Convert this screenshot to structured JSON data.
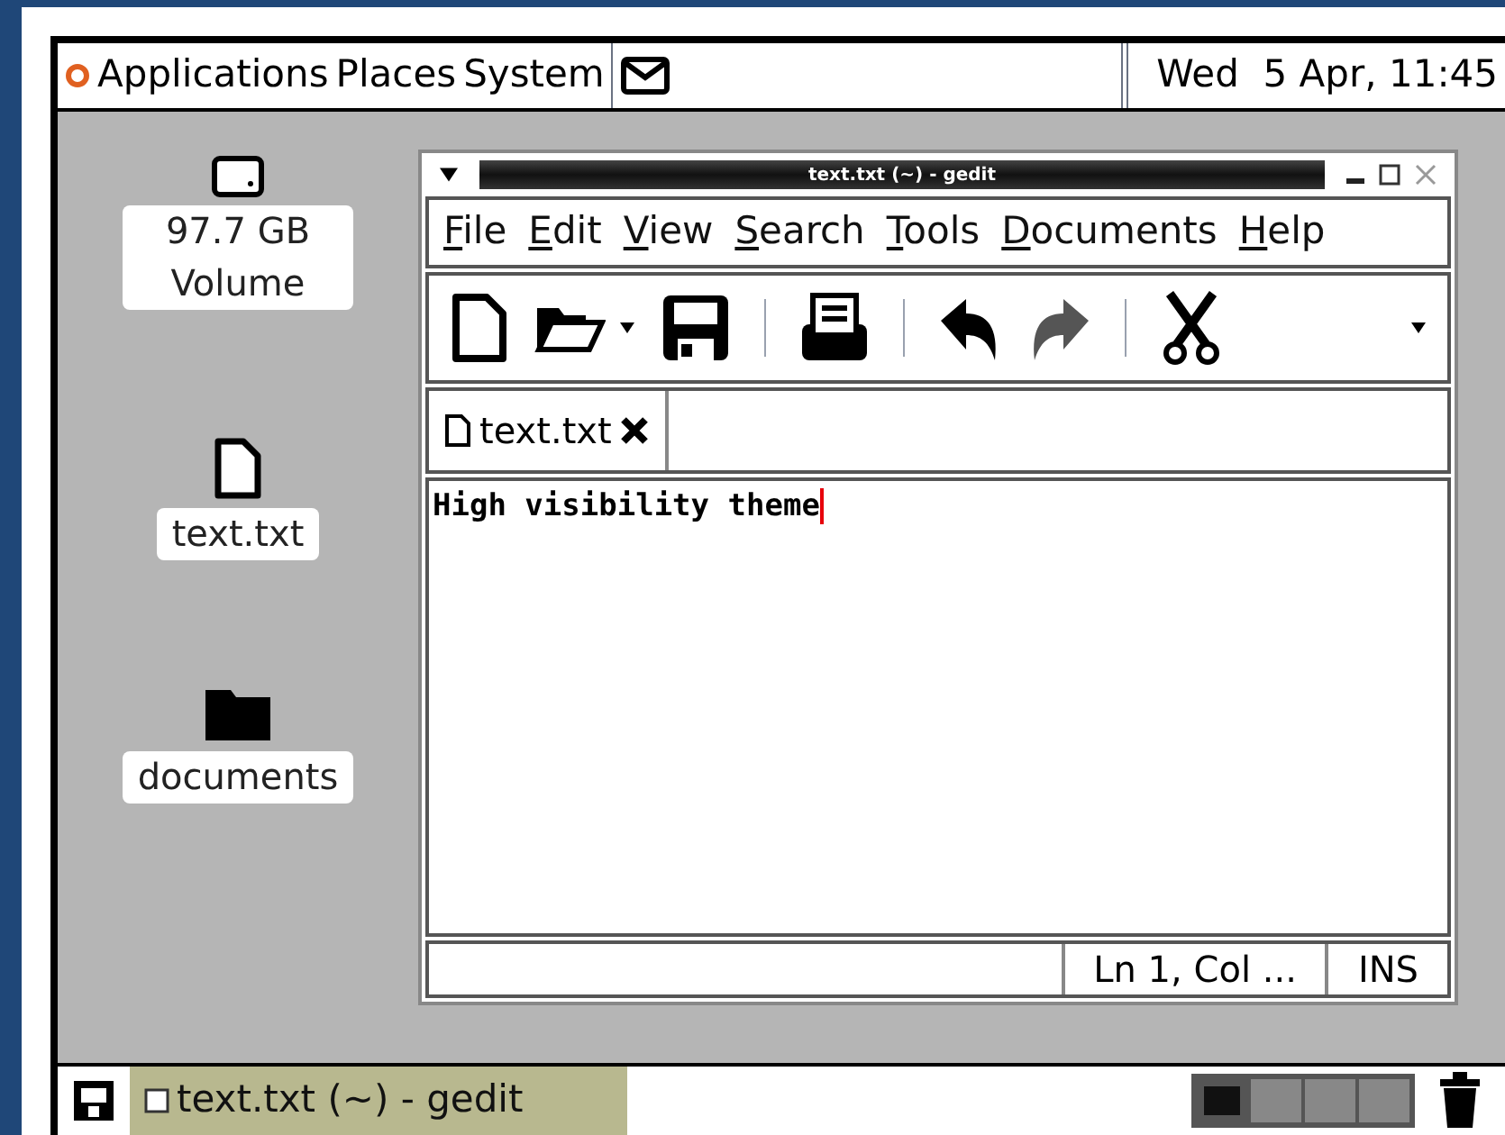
{
  "panel": {
    "menus": [
      "Applications",
      "Places",
      "System"
    ],
    "clock": "Wed  5 Apr, 11:45"
  },
  "desktop_icons": [
    {
      "kind": "drive",
      "label": "97.7 GB Volume"
    },
    {
      "kind": "file",
      "label": "text.txt"
    },
    {
      "kind": "folder",
      "label": "documents"
    }
  ],
  "window": {
    "title": "text.txt (~) - gedit",
    "menu": [
      "File",
      "Edit",
      "View",
      "Search",
      "Tools",
      "Documents",
      "Help"
    ],
    "toolbar": [
      {
        "kind": "new",
        "disabled": false
      },
      {
        "kind": "open",
        "disabled": false
      },
      {
        "kind": "save",
        "disabled": false
      },
      {
        "kind": "sep"
      },
      {
        "kind": "print",
        "disabled": false
      },
      {
        "kind": "sep"
      },
      {
        "kind": "undo",
        "disabled": false
      },
      {
        "kind": "redo",
        "disabled": true
      },
      {
        "kind": "sep"
      },
      {
        "kind": "cut",
        "disabled": false
      }
    ],
    "tabs": [
      {
        "label": "text.txt",
        "selected": true
      }
    ],
    "text": "High visibility theme",
    "status_bar": {
      "position": "Ln 1, Col ...",
      "mode": "INS"
    }
  },
  "taskbar": {
    "tasks": [
      {
        "label": "text.txt (~) - gedit",
        "selected": true
      }
    ],
    "workspaces": [
      {
        "selected": true
      },
      {
        "selected": false
      },
      {
        "selected": false
      },
      {
        "selected": false
      }
    ]
  }
}
